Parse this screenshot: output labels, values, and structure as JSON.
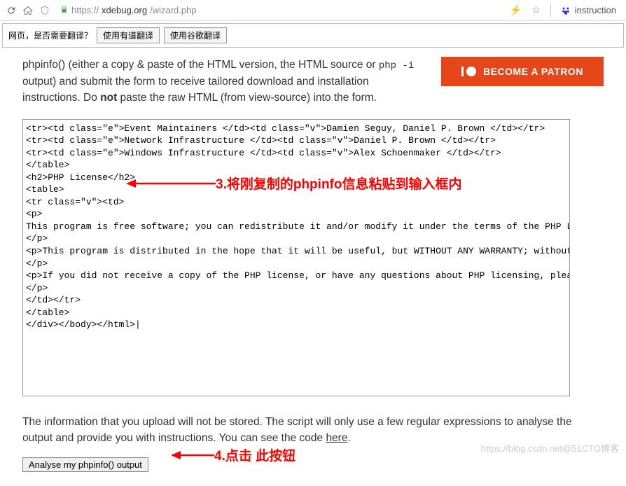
{
  "browser": {
    "url_protocol": "https://",
    "url_host": "xdebug.org",
    "url_path": "/wizard.php",
    "search_hint": "instruction"
  },
  "translate": {
    "prompt": "网页，是否需要翻译？",
    "youdao": "使用有道翻译",
    "google": "使用谷歌翻译"
  },
  "intro": {
    "part1": "phpinfo() (either a copy & paste of the HTML version, the HTML source or ",
    "code": "php -i",
    "part2": " output) and submit the form to receive tailored download and installation instructions. Do ",
    "bold": "not",
    "part3": " paste the raw HTML (from view-source) into the form."
  },
  "patron": {
    "label": "BECOME A PATRON"
  },
  "textarea_value": "<tr><td class=\"e\">Event Maintainers </td><td class=\"v\">Damien Seguy, Daniel P. Brown </td></tr>\n<tr><td class=\"e\">Network Infrastructure </td><td class=\"v\">Daniel P. Brown </td></tr>\n<tr><td class=\"e\">Windows Infrastructure </td><td class=\"v\">Alex Schoenmaker </td></tr>\n</table>\n<h2>PHP License</h2>\n<table>\n<tr class=\"v\"><td>\n<p>\nThis program is free software; you can redistribute it and/or modify it under the terms of the PHP License as published by the PHP Group and included in the distribution in the file:  LICENSE\n</p>\n<p>This program is distributed in the hope that it will be useful, but WITHOUT ANY WARRANTY; without even the implied warranty of MERCHANTABILITY or FITNESS FOR A PARTICULAR PURPOSE.\n</p>\n<p>If you did not receive a copy of the PHP license, or have any questions about PHP licensing, please contact license@php.net.\n</p>\n</td></tr>\n</table>\n</div></body></html>|",
  "info": {
    "part1": "The information that you upload will not be stored. The script will only use a few regular expressions to analyse the output and provide you with instructions. You can see the code ",
    "link": "here",
    "part2": "."
  },
  "button": {
    "analyse": "Analyse my phpinfo() output"
  },
  "annotations": {
    "step3": "3.将刚复制的phpinfo信息粘贴到输入框内",
    "step4": "4.点击 此按钮"
  },
  "watermark": "https://blog.csdn.net@51CTO博客"
}
